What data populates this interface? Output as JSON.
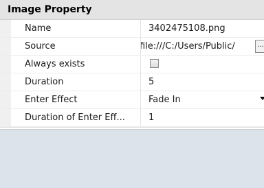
{
  "header": {
    "title": "Image Property"
  },
  "rows": [
    {
      "name": "Name",
      "value": "3402475108.png"
    },
    {
      "name": "Source",
      "value": "file:///C:/Users/Public/",
      "button_label": "..."
    },
    {
      "name": "Always exists",
      "checked": false
    },
    {
      "name": "Duration",
      "value": "5"
    },
    {
      "name": "Enter Effect",
      "value": "Fade In"
    },
    {
      "name": "Duration of Enter Eff...",
      "value": "1"
    }
  ],
  "icons": {
    "dropdown": "chevron-down-icon",
    "checkbox": "checkbox-unchecked-icon"
  }
}
